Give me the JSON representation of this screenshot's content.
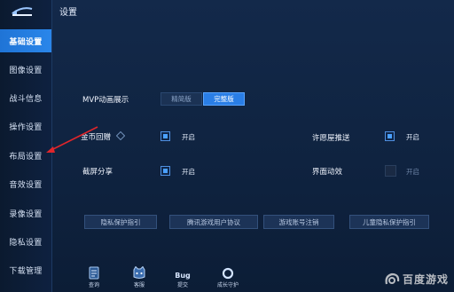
{
  "sidebar": {
    "items": [
      {
        "label": "基础设置",
        "active": true
      },
      {
        "label": "图像设置"
      },
      {
        "label": "战斗信息"
      },
      {
        "label": "操作设置"
      },
      {
        "label": "布局设置"
      },
      {
        "label": "音效设置"
      },
      {
        "label": "录像设置"
      },
      {
        "label": "隐私设置"
      },
      {
        "label": "下载管理"
      }
    ]
  },
  "header": {
    "title": "设置"
  },
  "mvp": {
    "label": "MVP动画展示",
    "options": [
      {
        "label": "精简版",
        "selected": false
      },
      {
        "label": "完整版",
        "selected": true
      }
    ]
  },
  "settings": {
    "coin_replay": {
      "label": "金币回赠",
      "state": "开启",
      "checked": true
    },
    "wish_push": {
      "label": "许愿屋推送",
      "state": "开启",
      "checked": true
    },
    "screenshot_share": {
      "label": "截屏分享",
      "state": "开启",
      "checked": true
    },
    "ui_motion": {
      "label": "界面动效",
      "state": "开启",
      "checked": false
    }
  },
  "links": [
    "隐私保护指引",
    "腾讯游戏用户协议",
    "游戏账号注销",
    "儿童隐私保护指引"
  ],
  "bottom_bar": [
    {
      "label": "查询",
      "icon": "document-icon"
    },
    {
      "label": "客服",
      "icon": "service-cat-icon"
    },
    {
      "label": "提交",
      "icon": "bug-icon",
      "icon_text": "Bug"
    },
    {
      "label": "成长守护",
      "icon": "ring-icon"
    }
  ],
  "watermark": {
    "text": "百度游戏"
  },
  "colors": {
    "accent": "#2a7ee6",
    "annotation_arrow": "#e0262b"
  }
}
